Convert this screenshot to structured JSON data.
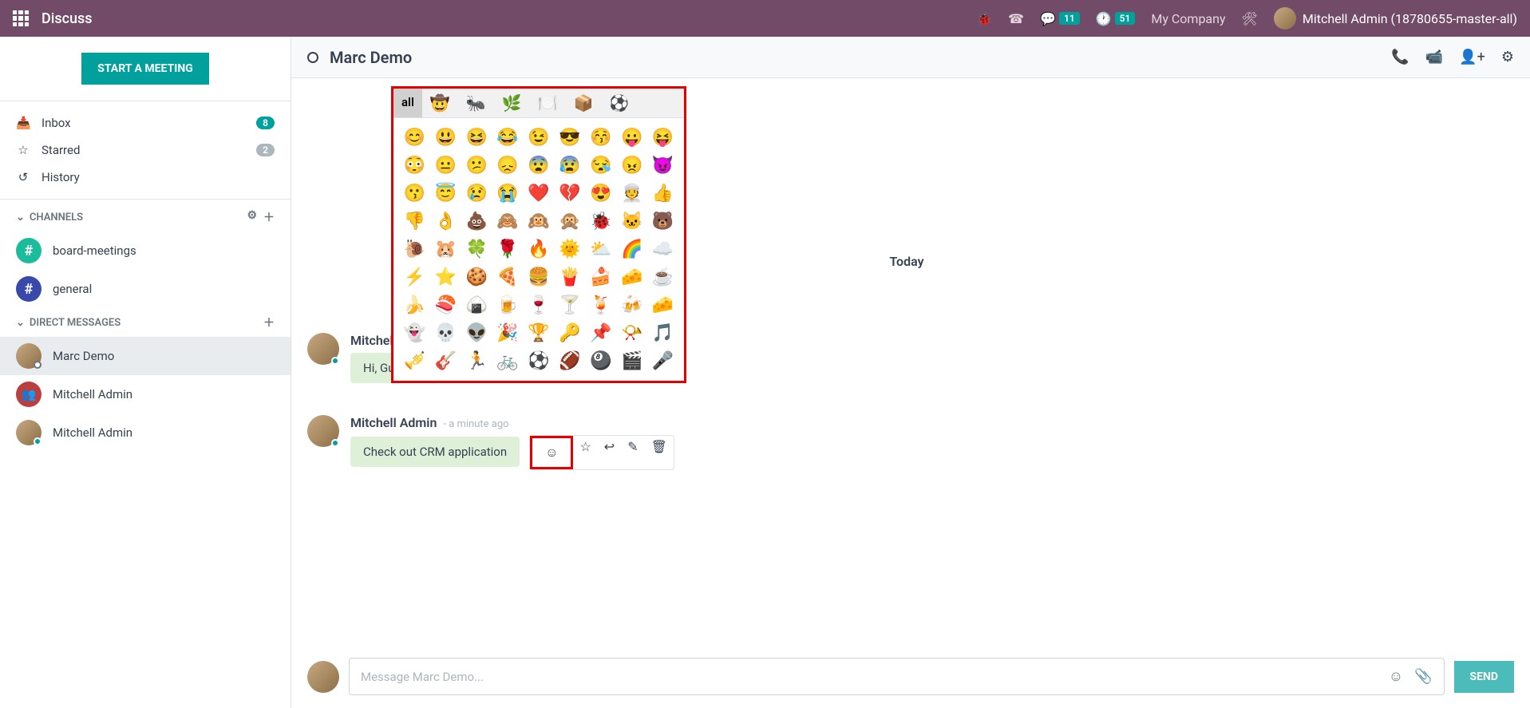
{
  "topbar": {
    "app_title": "Discuss",
    "messages_badge": "11",
    "activities_badge": "51",
    "company": "My Company",
    "user_name": "Mitchell Admin (18780655-master-all)"
  },
  "sidebar": {
    "start_meeting_label": "START A MEETING",
    "nav": [
      {
        "icon": "inbox",
        "label": "Inbox",
        "badge": "8",
        "badge_type": "green"
      },
      {
        "icon": "star",
        "label": "Starred",
        "badge": "2",
        "badge_type": "gray"
      },
      {
        "icon": "history",
        "label": "History"
      }
    ],
    "channels_header": "CHANNELS",
    "channels": [
      {
        "label": "board-meetings",
        "color": "#1abc9c"
      },
      {
        "label": "general",
        "color": "#3949ab"
      }
    ],
    "dm_header": "DIRECT MESSAGES",
    "dms": [
      {
        "label": "Marc Demo",
        "active": true,
        "type": "user"
      },
      {
        "label": "Mitchell Admin",
        "type": "group"
      },
      {
        "label": "Mitchell Admin",
        "type": "user"
      }
    ]
  },
  "chat": {
    "title": "Marc Demo",
    "today_label": "Today",
    "messages": [
      {
        "author": "Mitchell Admin",
        "time": "",
        "body": "Hi, Gu"
      },
      {
        "author": "Mitchell Admin",
        "time": "- a minute ago",
        "body": "Check out CRM application"
      }
    ],
    "composer_placeholder": "Message Marc Demo...",
    "send_label": "SEND"
  },
  "emoji_picker": {
    "tabs": [
      "all",
      "🤠",
      "🐜",
      "🌿",
      "🍽️",
      "📦",
      "⚽"
    ],
    "emojis": [
      "😊",
      "😃",
      "😆",
      "😂",
      "😉",
      "😎",
      "😚",
      "😛",
      "😝",
      "😳",
      "😐",
      "😕",
      "😞",
      "😨",
      "😰",
      "😪",
      "😠",
      "😈",
      "😗",
      "😇",
      "😢",
      "😭",
      "❤️",
      "💔",
      "😍",
      "👳",
      "👍",
      "👎",
      "👌",
      "💩",
      "🙈",
      "🙉",
      "🙊",
      "🐞",
      "🐱",
      "🐻",
      "🐌",
      "🐹",
      "🍀",
      "🌹",
      "🔥",
      "🌞",
      "⛅",
      "🌈",
      "☁️",
      "⚡",
      "⭐",
      "🍪",
      "🍕",
      "🍔",
      "🍟",
      "🍰",
      "🧀",
      "☕",
      "🍌",
      "🍣",
      "🍙",
      "🍺",
      "🍷",
      "🍸",
      "🍹",
      "🍻",
      "🧀",
      "👻",
      "💀",
      "👽",
      "🎉",
      "🏆",
      "🔑",
      "📌",
      "📯",
      "🎵",
      "🎺",
      "🎸",
      "🏃",
      "🚲",
      "⚽",
      "🏈",
      "🎱",
      "🎬",
      "🎤"
    ]
  }
}
